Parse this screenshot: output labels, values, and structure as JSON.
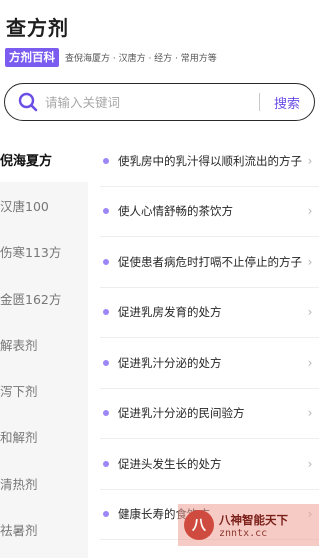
{
  "header": {
    "title": "查方剂"
  },
  "tagline": {
    "badge": "方剂百科",
    "desc": "查倪海厦方 · 汉唐方 · 经方 · 常用方等"
  },
  "search": {
    "placeholder": "请输入关键词",
    "button_label": "搜索",
    "value": ""
  },
  "sidebar": {
    "items": [
      {
        "label": "倪海夏方",
        "active": true
      },
      {
        "label": "汉唐100",
        "active": false
      },
      {
        "label": "伤寒113方",
        "active": false
      },
      {
        "label": "金匮162方",
        "active": false
      },
      {
        "label": "解表剂",
        "active": false
      },
      {
        "label": "泻下剂",
        "active": false
      },
      {
        "label": "和解剂",
        "active": false
      },
      {
        "label": "清热剂",
        "active": false
      },
      {
        "label": "祛暑剂",
        "active": false
      }
    ]
  },
  "list": {
    "items": [
      "使乳房中的乳汁得以顺利流出的方子",
      "使人心情舒畅的茶饮方",
      "促使患者病危时打嗝不止停止的方子",
      "促进乳房发育的处方",
      "促进乳汁分泌的处方",
      "促进乳汁分泌的民间验方",
      "促进头发生长的处方",
      "健康长寿的食饮方"
    ]
  },
  "watermark": {
    "line1": "八神智能天下",
    "line2": "znntx.cc",
    "logo_char": "八"
  },
  "colors": {
    "accent": "#7a5cf0",
    "search_button": "#6b4ee6",
    "dot": "#9d86f5"
  }
}
